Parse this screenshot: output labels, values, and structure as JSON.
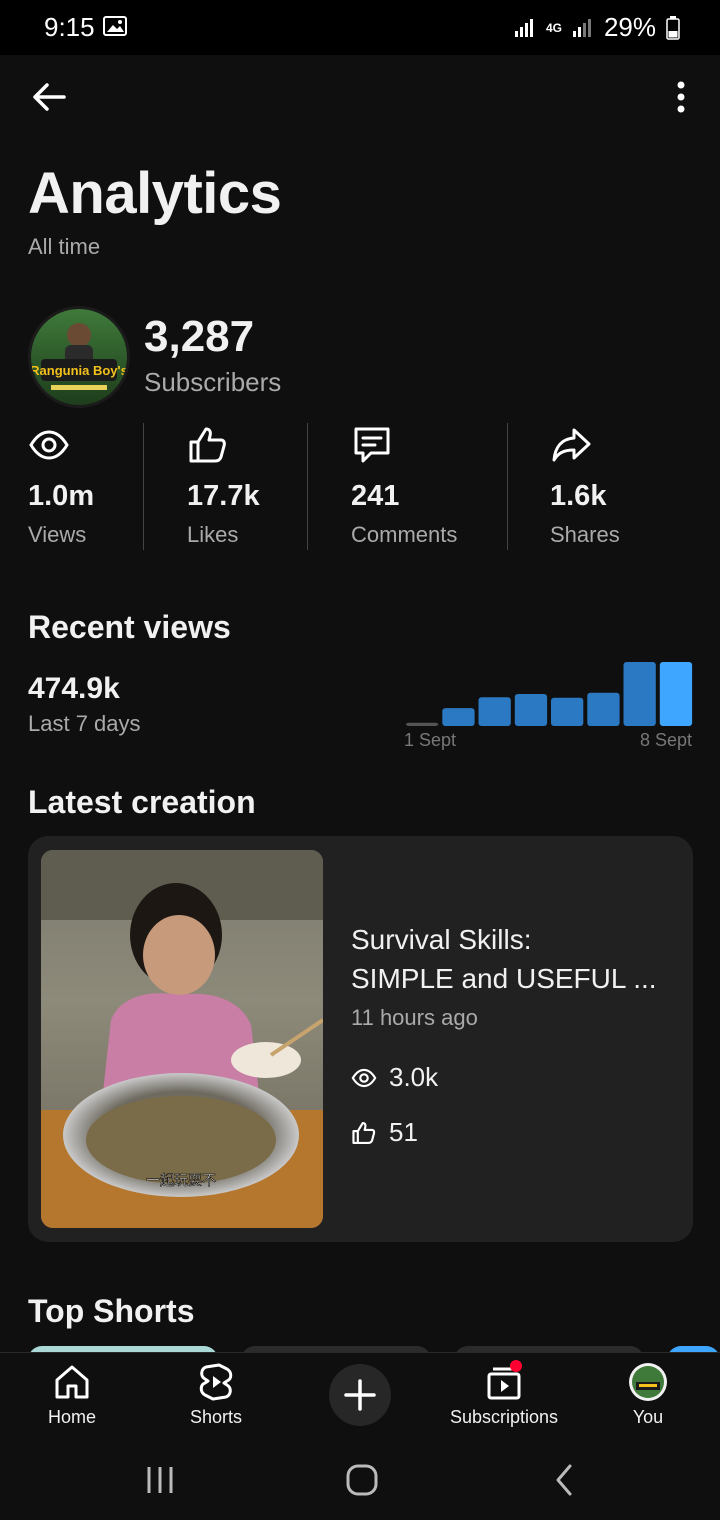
{
  "status_bar": {
    "time": "9:15",
    "network": "4G",
    "battery": "29%"
  },
  "header": {
    "title": "Analytics",
    "subtitle": "All time"
  },
  "channel": {
    "subscriber_count": "3,287",
    "subscriber_label": "Subscribers",
    "avatar_text": "Rangunia Boy's"
  },
  "stats": [
    {
      "icon": "eye-icon",
      "value": "1.0m",
      "label": "Views"
    },
    {
      "icon": "thumbs-up-icon",
      "value": "17.7k",
      "label": "Likes"
    },
    {
      "icon": "comment-icon",
      "value": "241",
      "label": "Comments"
    },
    {
      "icon": "share-icon",
      "value": "1.6k",
      "label": "Shares"
    }
  ],
  "recent_views": {
    "title": "Recent views",
    "value": "474.9k",
    "period": "Last 7 days",
    "axis_start": "1 Sept",
    "axis_end": "8 Sept",
    "bar_levels": [
      0.05,
      0.28,
      0.45,
      0.5,
      0.44,
      0.52,
      1.0,
      1.0
    ],
    "bar_color": "#2b79c2",
    "highlight_color": "#3ea6ff"
  },
  "latest_creation": {
    "title": "Latest creation",
    "video_title_line1": "Survival Skills:",
    "video_title_line2": "SIMPLE and USEFUL ...",
    "time_ago": "11 hours ago",
    "views": "3.0k",
    "likes": "51",
    "thumb_caption": "一起玩耍不"
  },
  "top_shorts": {
    "title": "Top Shorts"
  },
  "bottom_nav": [
    {
      "icon": "home-icon",
      "label": "Home"
    },
    {
      "icon": "shorts-icon",
      "label": "Shorts"
    },
    {
      "icon": "create-icon",
      "label": ""
    },
    {
      "icon": "subscriptions-icon",
      "label": "Subscriptions"
    },
    {
      "icon": "avatar-icon",
      "label": "You"
    }
  ]
}
